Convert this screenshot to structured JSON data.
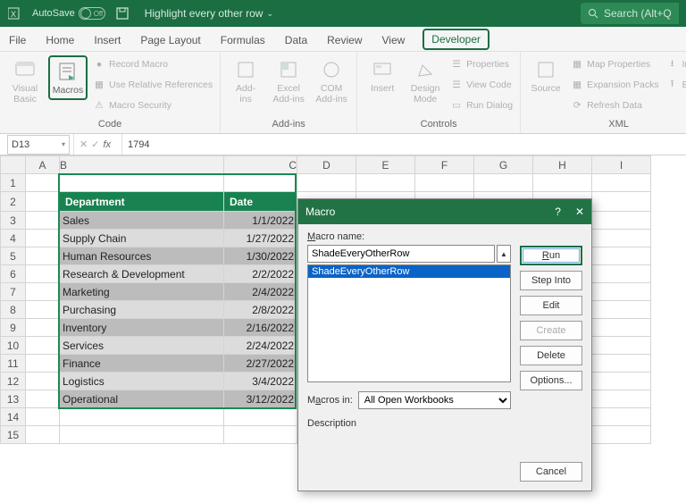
{
  "titlebar": {
    "autosave_label": "AutoSave",
    "autosave_state": "Off",
    "doc_title": "Highlight every other row",
    "search_placeholder": "Search (Alt+Q"
  },
  "tabs": {
    "file": "File",
    "home": "Home",
    "insert": "Insert",
    "page_layout": "Page Layout",
    "formulas": "Formulas",
    "data": "Data",
    "review": "Review",
    "view": "View",
    "developer": "Developer"
  },
  "ribbon": {
    "code": {
      "label": "Code",
      "visual_basic": "Visual\nBasic",
      "macros": "Macros",
      "record_macro": "Record Macro",
      "use_relative": "Use Relative References",
      "macro_security": "Macro Security"
    },
    "addins": {
      "label": "Add-ins",
      "addins": "Add-\nins",
      "excel_addins": "Excel\nAdd-ins",
      "com_addins": "COM\nAdd-ins"
    },
    "controls": {
      "label": "Controls",
      "insert": "Insert",
      "design_mode": "Design\nMode",
      "properties": "Properties",
      "view_code": "View Code",
      "run_dialog": "Run Dialog"
    },
    "source": {
      "label": "XML",
      "source": "Source",
      "map_properties": "Map Properties",
      "expansion_packs": "Expansion Packs",
      "refresh_data": "Refresh Data",
      "import": "Import",
      "export": "Export"
    }
  },
  "formulabar": {
    "cell_ref": "D13",
    "value": "1794"
  },
  "columns": [
    "A",
    "B",
    "C",
    "D",
    "E",
    "F",
    "G",
    "H",
    "I"
  ],
  "rows": [
    1,
    2,
    3,
    4,
    5,
    6,
    7,
    8,
    9,
    10,
    11,
    12,
    13,
    14,
    15
  ],
  "data": {
    "headers": {
      "dept": "Department",
      "date": "Date"
    },
    "rows": [
      {
        "dept": "Sales",
        "date": "1/1/2022"
      },
      {
        "dept": "Supply Chain",
        "date": "1/27/2022"
      },
      {
        "dept": "Human Resources",
        "date": "1/30/2022"
      },
      {
        "dept": "Research & Development",
        "date": "2/2/2022"
      },
      {
        "dept": "Marketing",
        "date": "2/4/2022"
      },
      {
        "dept": "Purchasing",
        "date": "2/8/2022"
      },
      {
        "dept": "Inventory",
        "date": "2/16/2022"
      },
      {
        "dept": "Services",
        "date": "2/24/2022"
      },
      {
        "dept": "Finance",
        "date": "2/27/2022"
      },
      {
        "dept": "Logistics",
        "date": "3/4/2022"
      },
      {
        "dept": "Operational",
        "date": "3/12/2022"
      }
    ]
  },
  "dialog": {
    "title": "Macro",
    "help": "?",
    "close": "✕",
    "macro_name_label": "Macro name:",
    "macro_name_value": "ShadeEveryOtherRow",
    "list_item": "ShadeEveryOtherRow",
    "macros_in_label": "Macros in:",
    "macros_in_value": "All Open Workbooks",
    "description_label": "Description",
    "buttons": {
      "run": "Run",
      "step_into": "Step Into",
      "edit": "Edit",
      "create": "Create",
      "delete": "Delete",
      "options": "Options...",
      "cancel": "Cancel"
    }
  }
}
